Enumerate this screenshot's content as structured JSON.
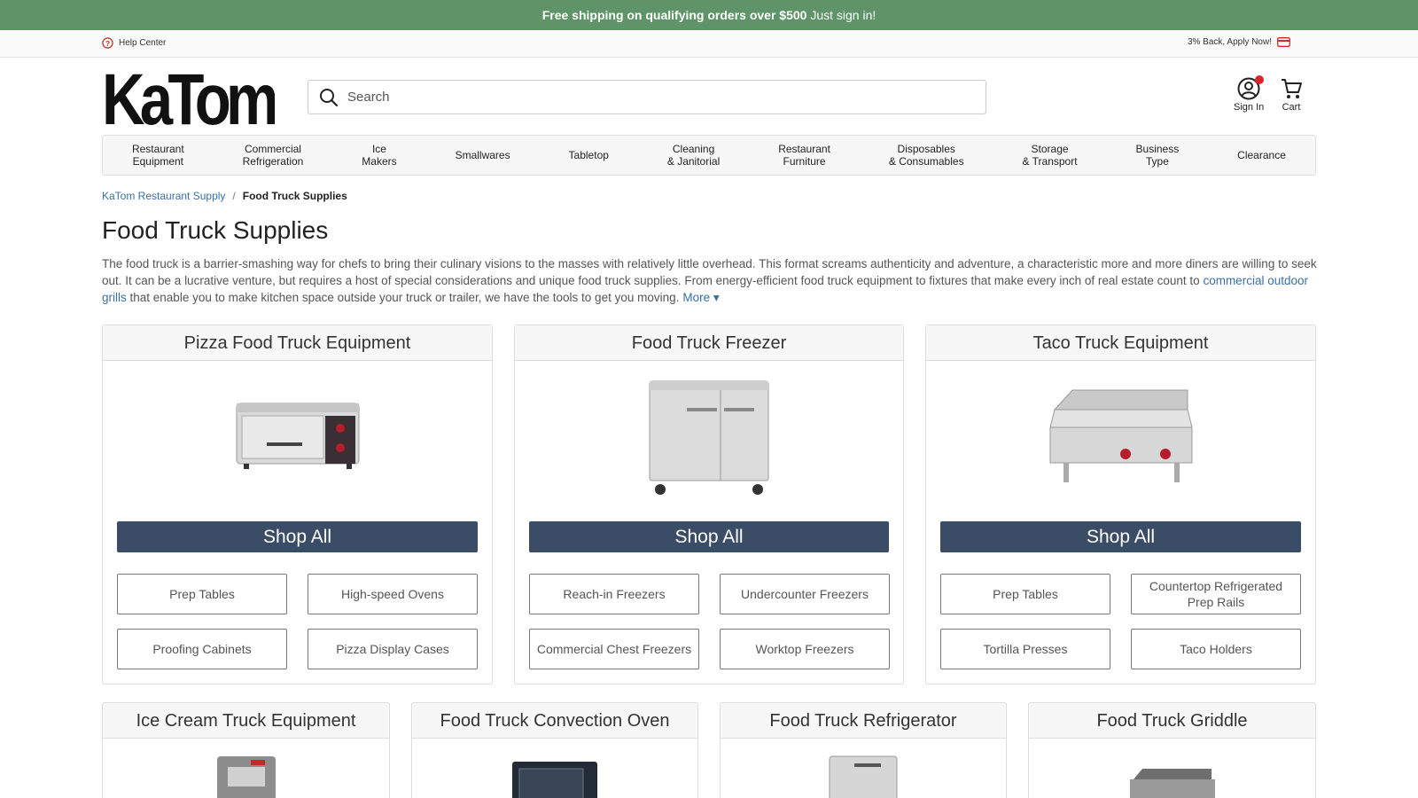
{
  "promo": {
    "bold": "Free shipping on qualifying orders over $500",
    "rest": " Just sign in!"
  },
  "utility": {
    "help": "Help Center",
    "cashback": "3% Back, Apply Now!"
  },
  "header": {
    "logo_text": "KaTom",
    "search_placeholder": "Search",
    "sign_in": "Sign In",
    "cart": "Cart"
  },
  "nav": [
    "Restaurant\nEquipment",
    "Commercial\nRefrigeration",
    "Ice\nMakers",
    "Smallwares",
    "Tabletop",
    "Cleaning\n& Janitorial",
    "Restaurant\nFurniture",
    "Disposables\n& Consumables",
    "Storage\n& Transport",
    "Business\nType",
    "Clearance"
  ],
  "breadcrumb": {
    "home": "KaTom Restaurant Supply",
    "sep": "/",
    "current": "Food Truck Supplies"
  },
  "page": {
    "title": "Food Truck Supplies",
    "intro_1": "The food truck is a barrier-smashing way for chefs to bring their culinary visions to the masses with relatively little overhead. This format screams authenticity and adventure, a characteristic more and more diners are willing to seek out. It can be a lucrative venture, but requires a host of special considerations and unique food truck supplies. From energy-efficient food truck equipment to fixtures that make every inch of real estate count to ",
    "intro_link": "commercial outdoor grills",
    "intro_2": " that enable you to make kitchen space outside your truck or trailer, we have the tools to get you moving.",
    "more": "More ▾"
  },
  "cards_top": [
    {
      "title": "Pizza Food Truck Equipment",
      "shop": "Shop All",
      "links": [
        "Prep Tables",
        "High-speed Ovens",
        "Proofing Cabinets",
        "Pizza Display Cases"
      ]
    },
    {
      "title": "Food Truck Freezer",
      "shop": "Shop All",
      "links": [
        "Reach-in Freezers",
        "Undercounter Freezers",
        "Commercial Chest Freezers",
        "Worktop Freezers"
      ]
    },
    {
      "title": "Taco Truck Equipment",
      "shop": "Shop All",
      "links": [
        "Prep Tables",
        "Countertop Refrigerated Prep Rails",
        "Tortilla Presses",
        "Taco Holders"
      ]
    }
  ],
  "cards_bottom": [
    {
      "title": "Ice Cream Truck Equipment"
    },
    {
      "title": "Food Truck Convection Oven"
    },
    {
      "title": "Food Truck Refrigerator"
    },
    {
      "title": "Food Truck Griddle"
    }
  ],
  "colors": {
    "promo_bg": "#5e9467",
    "shop_btn": "#3b4d66",
    "link": "#3a6fa5",
    "badge": "#d9262c"
  }
}
